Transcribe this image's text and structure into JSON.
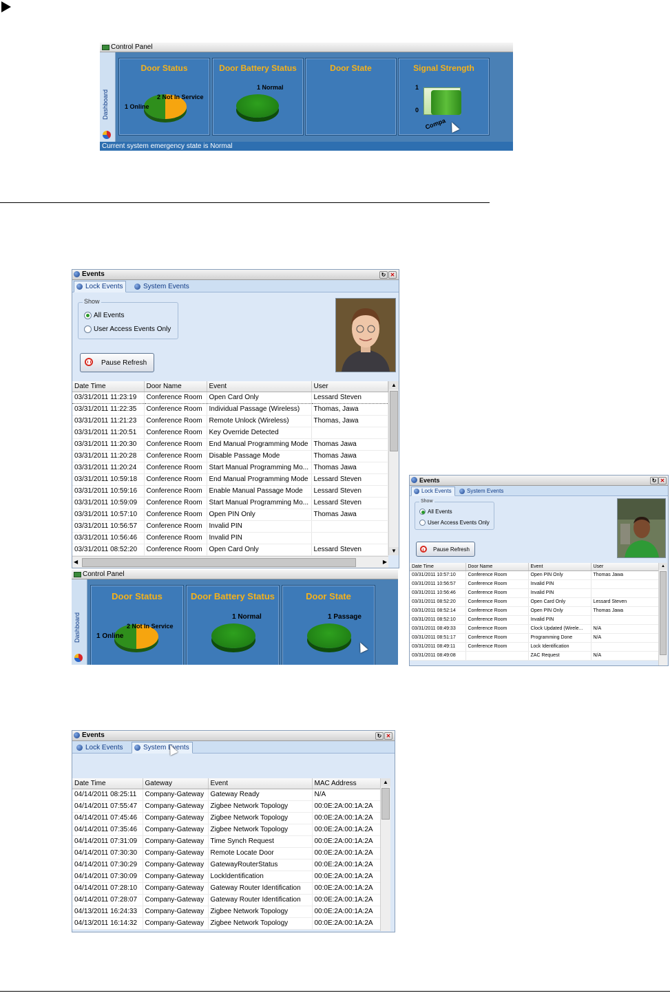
{
  "cp1": {
    "title": "Control Panel",
    "side_label": "Dashboard",
    "tiles": {
      "door_status": {
        "title": "Door Status",
        "label_a": "2 Not In Service",
        "label_b": "1 Online"
      },
      "battery": {
        "title": "Door Battery Status",
        "label": "1 Normal"
      },
      "door_state": {
        "title": "Door State"
      },
      "signal": {
        "title": "Signal Strength",
        "y_top": "1",
        "y_bottom": "0",
        "x_label": "Compa"
      }
    },
    "status_text": "Current system emergency state is Normal"
  },
  "ev1": {
    "title": "Events",
    "tabs": {
      "lock": "Lock Events",
      "system": "System Events"
    },
    "show_label": "Show",
    "radio_all": "All Events",
    "radio_user": "User Access Events Only",
    "pause_label": "Pause Refresh",
    "columns": [
      "Date Time",
      "Door Name",
      "Event",
      "User"
    ],
    "rows": [
      [
        "03/31/2011 11:23:19",
        "Conference Room",
        "Open Card Only",
        "Lessard Steven"
      ],
      [
        "03/31/2011 11:22:35",
        "Conference Room",
        "Individual Passage (Wireless)",
        "Thomas, Jawa"
      ],
      [
        "03/31/2011 11:21:23",
        "Conference Room",
        "Remote Unlock (Wireless)",
        "Thomas, Jawa"
      ],
      [
        "03/31/2011 11:20:51",
        "Conference Room",
        "Key Override Detected",
        ""
      ],
      [
        "03/31/2011 11:20:30",
        "Conference Room",
        "End Manual Programming Mode",
        "Thomas Jawa"
      ],
      [
        "03/31/2011 11:20:28",
        "Conference Room",
        "Disable Passage Mode",
        "Thomas Jawa"
      ],
      [
        "03/31/2011 11:20:24",
        "Conference Room",
        "Start Manual Programming Mo...",
        "Thomas Jawa"
      ],
      [
        "03/31/2011 10:59:18",
        "Conference Room",
        "End Manual Programming Mode",
        "Lessard Steven"
      ],
      [
        "03/31/2011 10:59:16",
        "Conference Room",
        "Enable Manual Passage Mode",
        "Lessard Steven"
      ],
      [
        "03/31/2011 10:59:09",
        "Conference Room",
        "Start Manual Programming Mo...",
        "Lessard Steven"
      ],
      [
        "03/31/2011 10:57:10",
        "Conference Room",
        "Open PIN Only",
        "Thomas Jawa"
      ],
      [
        "03/31/2011 10:56:57",
        "Conference Room",
        "Invalid PIN",
        ""
      ],
      [
        "03/31/2011 10:56:46",
        "Conference Room",
        "Invalid PIN",
        ""
      ],
      [
        "03/31/2011 08:52:20",
        "Conference Room",
        "Open Card Only",
        "Lessard Steven"
      ]
    ]
  },
  "cp2": {
    "title": "Control Panel",
    "side_label": "Dashboard",
    "tiles": {
      "door_status": {
        "title": "Door Status",
        "label_a": "2 Not In Service",
        "label_b": "1 Online"
      },
      "battery": {
        "title": "Door Battery Status",
        "label": "1 Normal"
      },
      "door_state": {
        "title": "Door State",
        "label": "1 Passage"
      }
    }
  },
  "ev2": {
    "title": "Events",
    "tabs": {
      "lock": "Lock Events",
      "system": "System Events"
    },
    "show_label": "Show",
    "radio_all": "All Events",
    "radio_user": "User Access Events Only",
    "pause_label": "Pause Refresh",
    "columns": [
      "Date Time",
      "Door Name",
      "Event",
      "User"
    ],
    "rows": [
      [
        "03/31/2011 10:57:10",
        "Conference Room",
        "Open PIN Only",
        "Thomas Jawa"
      ],
      [
        "03/31/2011 10:56:57",
        "Conference Room",
        "Invalid PIN",
        ""
      ],
      [
        "03/31/2011 10:56:46",
        "Conference Room",
        "Invalid PIN",
        ""
      ],
      [
        "03/31/2011 08:52:20",
        "Conference Room",
        "Open Card Only",
        "Lessard Steven"
      ],
      [
        "03/31/2011 08:52:14",
        "Conference Room",
        "Open PIN Only",
        "Thomas Jawa"
      ],
      [
        "03/31/2011 08:52:10",
        "Conference Room",
        "Invalid PIN",
        ""
      ],
      [
        "03/31/2011 08:49:33",
        "Conference Room",
        "Clock Updated (Wirele...",
        "N/A"
      ],
      [
        "03/31/2011 08:51:17",
        "Conference Room",
        "Programming Done",
        "N/A"
      ],
      [
        "03/31/2011 08:49:11",
        "Conference Room",
        "Lock Identification",
        ""
      ],
      [
        "03/31/2011 08:49:08",
        "",
        "ZAC Request",
        "N/A"
      ]
    ]
  },
  "ev3": {
    "title": "Events",
    "tabs": {
      "lock": "Lock Events",
      "system": "System Events"
    },
    "columns": [
      "Date Time",
      "Gateway",
      "Event",
      "MAC Address"
    ],
    "rows": [
      [
        "04/14/2011 08:25:11",
        "Company-Gateway",
        "Gateway Ready",
        "N/A"
      ],
      [
        "04/14/2011 07:55:47",
        "Company-Gateway",
        "Zigbee Network Topology",
        "00:0E:2A:00:1A:2A"
      ],
      [
        "04/14/2011 07:45:46",
        "Company-Gateway",
        "Zigbee Network Topology",
        "00:0E:2A:00:1A:2A"
      ],
      [
        "04/14/2011 07:35:46",
        "Company-Gateway",
        "Zigbee Network Topology",
        "00:0E:2A:00:1A:2A"
      ],
      [
        "04/14/2011 07:31:09",
        "Company-Gateway",
        "Time Synch Request",
        "00:0E:2A:00:1A:2A"
      ],
      [
        "04/14/2011 07:30:30",
        "Company-Gateway",
        "Remote Locate Door",
        "00:0E:2A:00:1A:2A"
      ],
      [
        "04/14/2011 07:30:29",
        "Company-Gateway",
        "GatewayRouterStatus",
        "00:0E:2A:00:1A:2A"
      ],
      [
        "04/14/2011 07:30:09",
        "Company-Gateway",
        "LockIdentification",
        "00:0E:2A:00:1A:2A"
      ],
      [
        "04/14/2011 07:28:10",
        "Company-Gateway",
        "Gateway Router Identification",
        "00:0E:2A:00:1A:2A"
      ],
      [
        "04/14/2011 07:28:07",
        "Company-Gateway",
        "Gateway Router Identification",
        "00:0E:2A:00:1A:2A"
      ],
      [
        "04/13/2011 16:24:33",
        "Company-Gateway",
        "Zigbee Network Topology",
        "00:0E:2A:00:1A:2A"
      ],
      [
        "04/13/2011 16:14:32",
        "Company-Gateway",
        "Zigbee Network Topology",
        "00:0E:2A:00:1A:2A"
      ]
    ]
  }
}
